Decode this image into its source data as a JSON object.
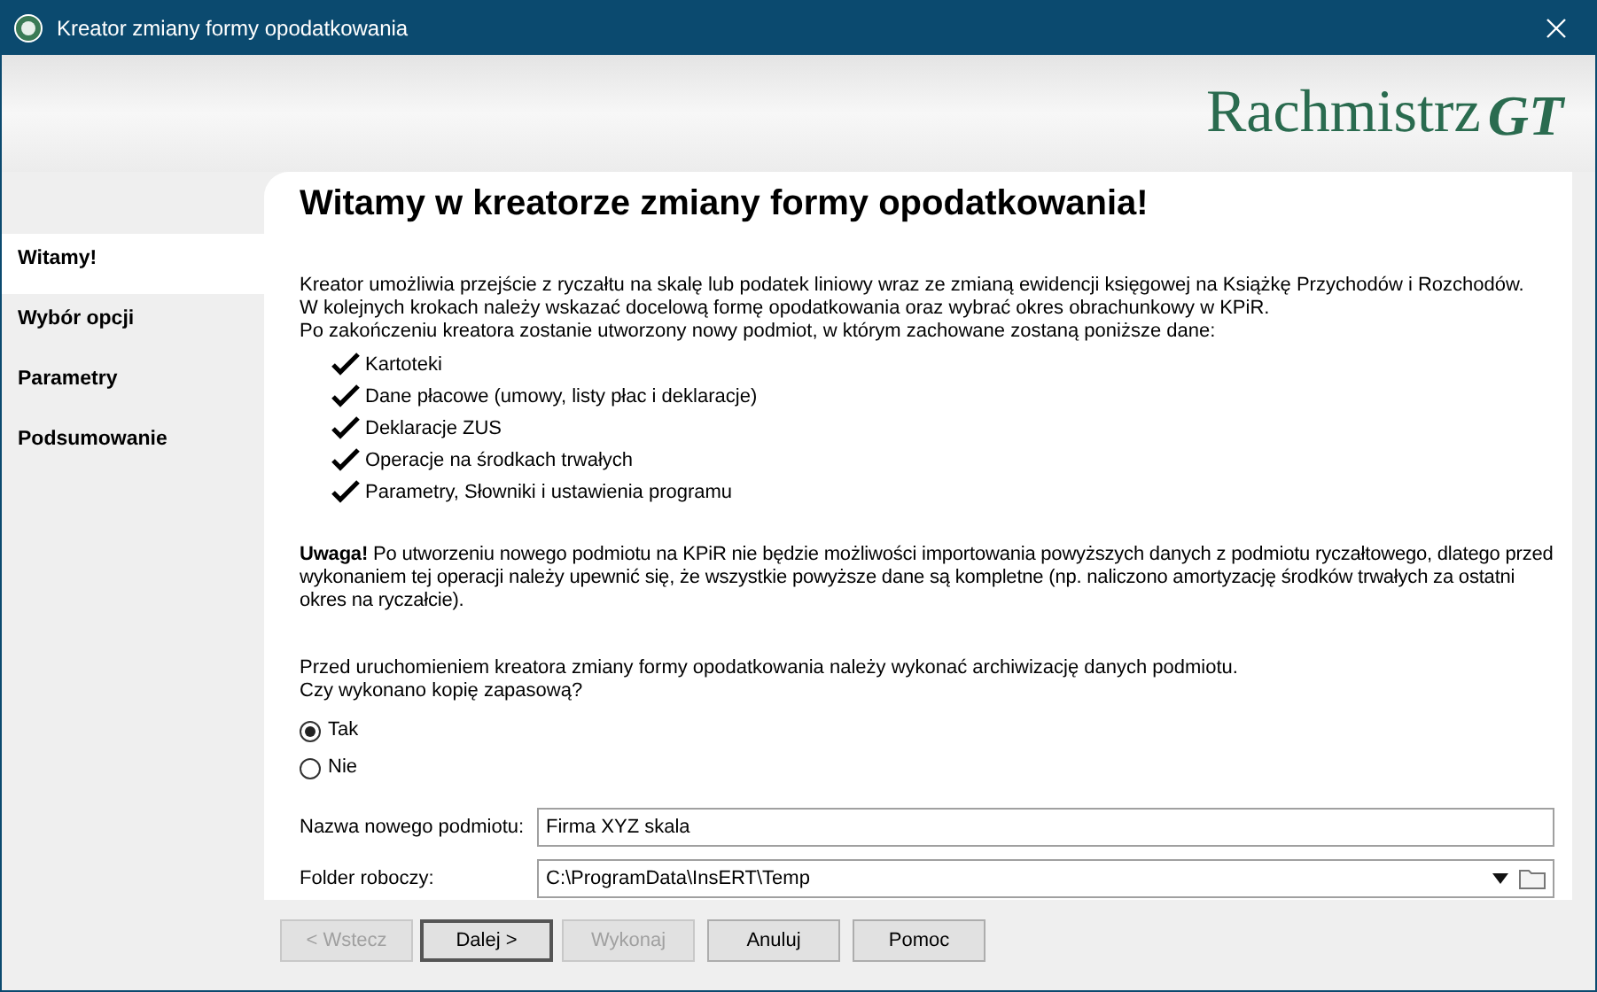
{
  "window": {
    "title": "Kreator zmiany formy opodatkowania"
  },
  "logo": {
    "name": "Rachmistrz",
    "mark": "GT"
  },
  "sidebar": {
    "items": [
      {
        "label": "Witamy!",
        "selected": true
      },
      {
        "label": "Wybór opcji",
        "selected": false
      },
      {
        "label": "Parametry",
        "selected": false
      },
      {
        "label": "Podsumowanie",
        "selected": false
      }
    ]
  },
  "heading": "Witamy w kreatorze zmiany formy opodatkowania!",
  "intro": [
    "Kreator umożliwia przejście z ryczałtu na skalę lub podatek liniowy wraz ze zmianą ewidencji księgowej na Książkę Przychodów i Rozchodów.",
    "W kolejnych krokach należy wskazać docelową formę opodatkowania oraz wybrać okres obrachunkowy w KPiR.",
    "Po zakończeniu kreatora zostanie utworzony nowy podmiot, w którym zachowane zostaną poniższe dane:"
  ],
  "kept_data": [
    "Kartoteki",
    "Dane płacowe (umowy, listy płac i deklaracje)",
    "Deklaracje ZUS",
    "Operacje na środkach trwałych",
    "Parametry, Słowniki i ustawienia programu"
  ],
  "warning": "**Uwaga!** Po utworzeniu nowego podmiotu na KPiR nie będzie możliwości importowania powyższych danych z podmiotu ryczałtowego, dlatego przed wykonaniem tej operacji należy upewnić się, że wszystkie powyższe dane są kompletne (np. naliczono amortyzację środków trwałych za ostatni okres na ryczałcie).",
  "backup_question": [
    "Przed uruchomieniem kreatora zmiany formy opodatkowania należy wykonać archiwizację danych podmiotu.",
    "Czy wykonano kopię zapasową?"
  ],
  "backup_options": [
    {
      "label": "Tak",
      "selected": true
    },
    {
      "label": "Nie",
      "selected": false
    }
  ],
  "fields": [
    {
      "kind": "text",
      "label": "Nazwa nowego podmiotu:",
      "value": "Firma XYZ skala"
    },
    {
      "kind": "folder",
      "label": "Folder roboczy:",
      "value": "C:\\ProgramData\\InsERT\\Temp"
    }
  ],
  "buttons": [
    {
      "label": "< Wstecz",
      "disabled": true,
      "default": false
    },
    {
      "label": "Dalej >",
      "disabled": false,
      "default": true
    },
    {
      "label": "Wykonaj",
      "disabled": true,
      "default": false
    },
    {
      "label": "Anuluj",
      "disabled": false,
      "default": false
    },
    {
      "label": "Pomoc",
      "disabled": false,
      "default": false
    }
  ]
}
